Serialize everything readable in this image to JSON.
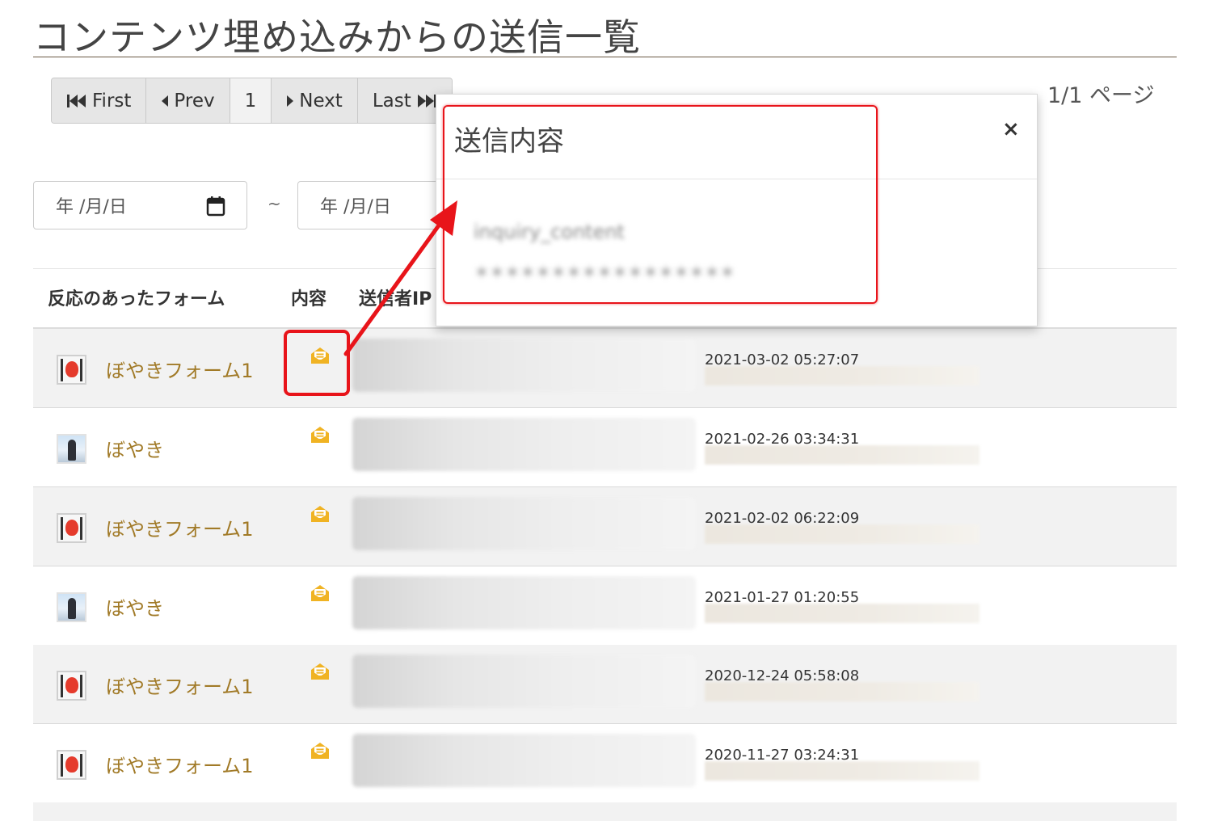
{
  "page": {
    "title": "コンテンツ埋め込みからの送信一覧",
    "page_count": "1/1 ページ"
  },
  "pagination": {
    "first": "First",
    "prev": "Prev",
    "current": "1",
    "next": "Next",
    "last": "Last"
  },
  "filter": {
    "date_from_placeholder": "年 /月/日",
    "separator": "~",
    "date_to_placeholder": "年 /月/日"
  },
  "table": {
    "headers": [
      "反応のあったフォーム",
      "内容",
      "送信者IP"
    ],
    "rows": [
      {
        "form": "ぼやきフォーム1",
        "avatar": "red-character",
        "date": "2021-03-02 05:27:07"
      },
      {
        "form": "ぼやき",
        "avatar": "person-photo",
        "date": "2021-02-26 03:34:31"
      },
      {
        "form": "ぼやきフォーム1",
        "avatar": "red-character",
        "date": "2021-02-02 06:22:09"
      },
      {
        "form": "ぼやき",
        "avatar": "person-photo",
        "date": "2021-01-27 01:20:55"
      },
      {
        "form": "ぼやきフォーム1",
        "avatar": "red-character",
        "date": "2020-12-24 05:58:08"
      },
      {
        "form": "ぼやきフォーム1",
        "avatar": "red-character",
        "date": "2020-11-27 03:24:31"
      }
    ]
  },
  "modal": {
    "title": "送信内容",
    "close": "×",
    "field_label": "inquiry_content",
    "field_value": "＊＊＊＊＊＊＊＊＊＊＊＊＊＊＊＊＊"
  },
  "colors": {
    "accent_gold": "#a17a27",
    "mail_icon": "#f0b323",
    "highlight_red": "#e8141a"
  },
  "icons": [
    "first-page-icon",
    "prev-icon",
    "next-icon",
    "last-page-icon",
    "calendar-icon",
    "mail-open-icon",
    "close-icon"
  ]
}
